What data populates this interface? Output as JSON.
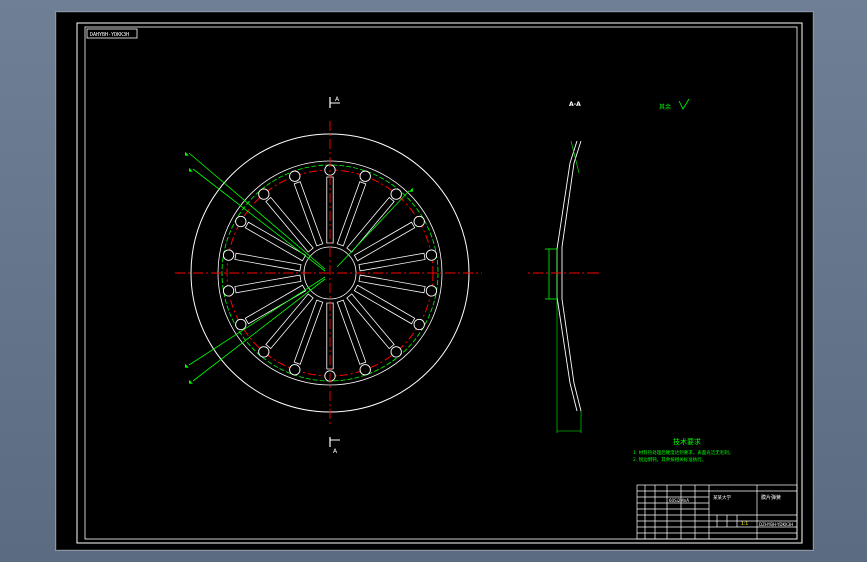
{
  "drawing": {
    "title_box_code": "DAHYBH-YDKK3H",
    "section_label": "A-A",
    "cut_label_top": "A",
    "cut_label_bottom": "A",
    "roughness_note": "其余",
    "tech_title": "技术要求",
    "tech_lines": [
      "1. 材料热处理后硬度达到要求，表面光洁无毛刺。",
      "2. 锐边倒钝，其余按相关标准执行。"
    ],
    "title_block": {
      "part_name": "膜片弹簧",
      "drawing_no": "DZHYBH-YDKK3H",
      "material": "60Si2MnA",
      "scale": "1:1",
      "company": "某某大学"
    }
  },
  "colors": {
    "white": "#ffffff",
    "green": "#00ff00",
    "red": "#ff0000",
    "yellow": "#ffff00"
  }
}
